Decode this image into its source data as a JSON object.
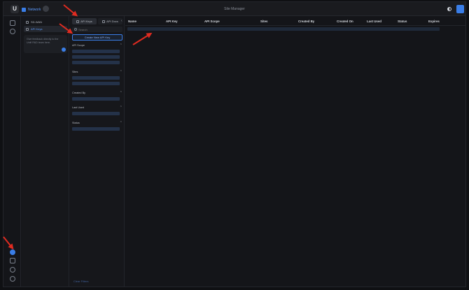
{
  "topbar": {
    "app_label": "Network",
    "title": "Site Manager"
  },
  "sidepanel": {
    "items": [
      {
        "label": "SD-WAN"
      },
      {
        "label": "API Keys"
      }
    ],
    "feedback_text": "Give feedback directly to the Unifi R&D team here."
  },
  "filters": {
    "tabs": [
      {
        "label": "API Keys"
      },
      {
        "label": "API Docs"
      }
    ],
    "search_placeholder": "Search",
    "create_label": "Create New API Key",
    "groups": [
      {
        "label": "API Scope"
      },
      {
        "label": "Sites"
      },
      {
        "label": "Created By"
      },
      {
        "label": "Last Used"
      },
      {
        "label": "Status"
      }
    ],
    "clear_label": "Clear Filters"
  },
  "table": {
    "columns": [
      "Name",
      "API Key",
      "API Scope",
      "Sites",
      "Created By",
      "Created On",
      "Last Used",
      "Status",
      "Expires"
    ]
  },
  "colors": {
    "accent": "#3a7ee8",
    "annotation_arrow": "#e02b20"
  }
}
